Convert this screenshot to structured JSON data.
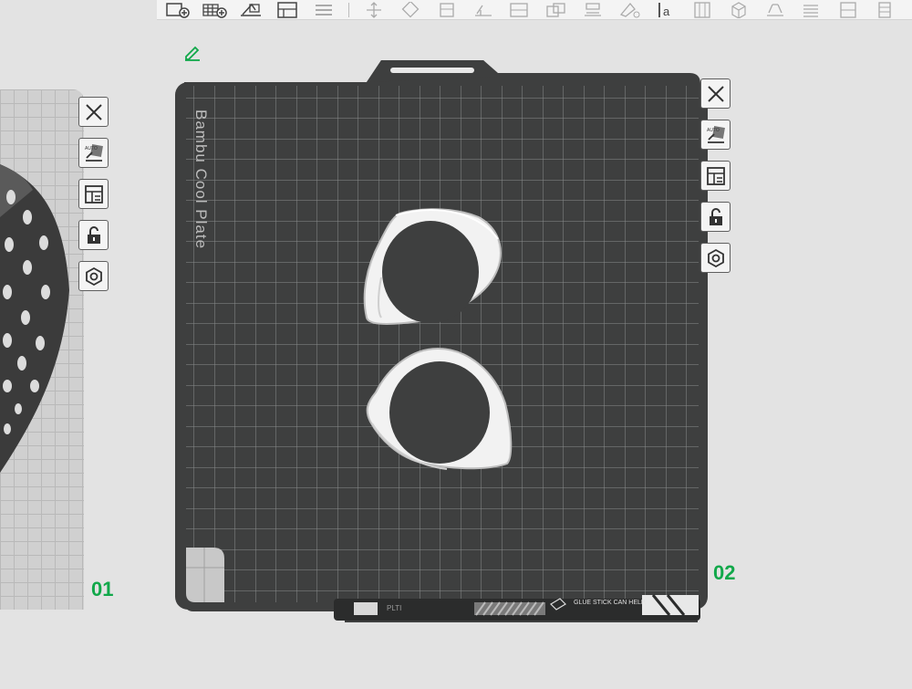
{
  "toolbar": {
    "icons": [
      "add-plate-icon",
      "auto-arrange-grid-icon",
      "auto-orient-icon",
      "split-objects-icon",
      "layers-icon",
      "move-icon",
      "rotate-icon",
      "cut-icon",
      "measure-icon",
      "assembly-icon",
      "seam-icon",
      "text-tool-icon",
      "support-paint-icon",
      "color-paint-icon",
      "slice-view-icon",
      "variable-layer-icon"
    ],
    "text_tool_label": "a"
  },
  "side_plate": {
    "label": "01",
    "tools": [
      "close-icon",
      "auto-orient-plate-icon",
      "arrange-plate-icon",
      "lock-open-icon",
      "plate-settings-icon"
    ]
  },
  "main_plate": {
    "label": "02",
    "brand_text": "Bambu Cool Plate",
    "footer_code": "PLTI",
    "footer_warning_line1": "GLUE STICK CAN HELP.",
    "tools": [
      "close-icon",
      "auto-orient-plate-icon",
      "arrange-plate-icon",
      "lock-open-icon",
      "plate-settings-icon"
    ]
  },
  "colors": {
    "plate_dark": "#3e3f3f",
    "grid_line": "#8a8c8c",
    "object_fill": "#f2f2f2",
    "label_green": "#11a84a"
  }
}
